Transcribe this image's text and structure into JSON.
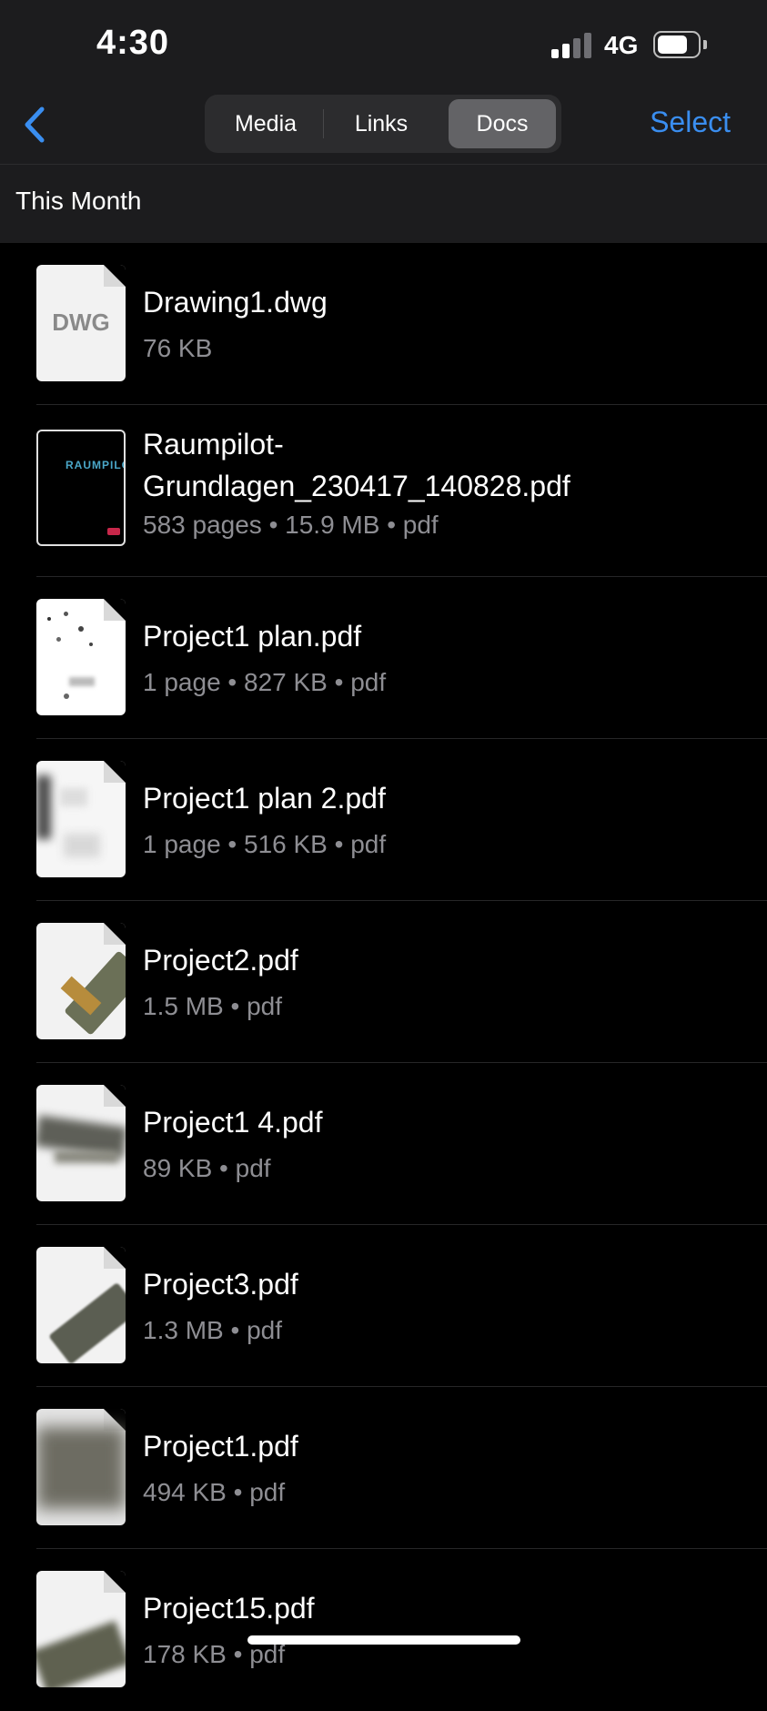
{
  "status_bar": {
    "time": "4:30",
    "network": "4G",
    "battery_level": 0.75,
    "signal_bars_active": 2,
    "signal_bars_total": 4
  },
  "nav": {
    "back_icon": "chevron-left-icon",
    "tabs": [
      {
        "label": "Media",
        "active": false
      },
      {
        "label": "Links",
        "active": false
      },
      {
        "label": "Docs",
        "active": true
      }
    ],
    "select_label": "Select"
  },
  "section": {
    "title": "This Month"
  },
  "files": [
    {
      "name": "Drawing1.dwg",
      "meta": "76 KB",
      "thumb_label": "DWG",
      "thumb_type": "dwg"
    },
    {
      "name": "Raumpilot-\nGrundlagen_230417_140828.pdf",
      "meta": "583 pages • 15.9 MB • pdf",
      "thumb_label": "RAUMPILO",
      "thumb_type": "cover-dark"
    },
    {
      "name": "Project1 plan.pdf",
      "meta": "1 page • 827 KB • pdf",
      "thumb_type": "dots"
    },
    {
      "name": "Project1 plan 2.pdf",
      "meta": "1 page • 516 KB • pdf",
      "thumb_type": "blur-light"
    },
    {
      "name": "Project2.pdf",
      "meta": "1.5 MB • pdf",
      "thumb_type": "model-green"
    },
    {
      "name": "Project1 4.pdf",
      "meta": "89 KB • pdf",
      "thumb_type": "model-grey"
    },
    {
      "name": "Project3.pdf",
      "meta": "1.3 MB • pdf",
      "thumb_type": "model-dark"
    },
    {
      "name": "Project1.pdf",
      "meta": "494 KB • pdf",
      "thumb_type": "blur-dark"
    },
    {
      "name": "Project15.pdf",
      "meta": "178 KB • pdf",
      "thumb_type": "model-green"
    }
  ],
  "colors": {
    "accent": "#3a8ef0",
    "background": "#000000",
    "bar_background": "#1c1c1e",
    "secondary_text": "#8e8e93"
  }
}
